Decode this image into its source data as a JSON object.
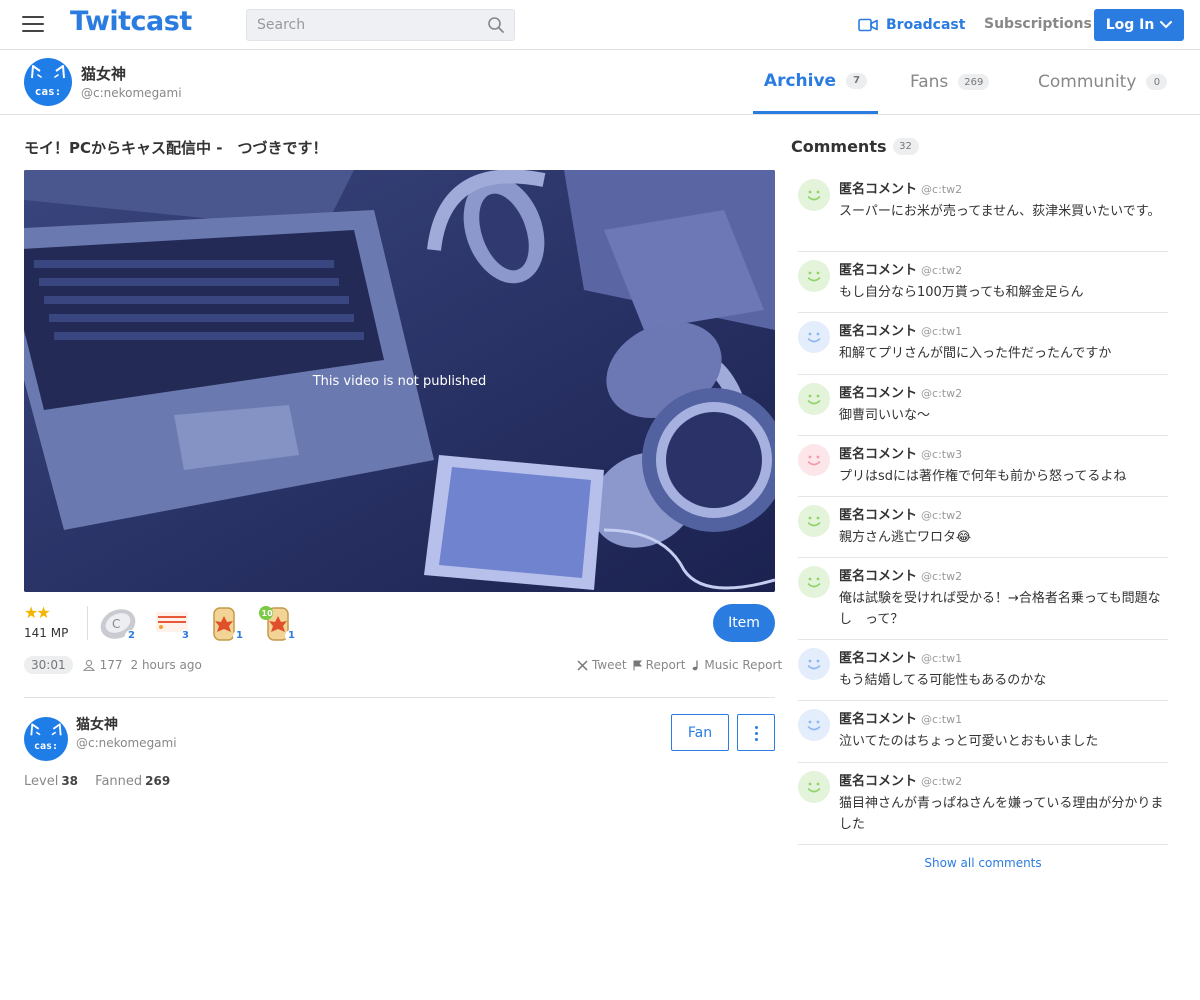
{
  "header": {
    "logo": "Twitcast",
    "search_placeholder": "Search",
    "broadcast_label": "Broadcast",
    "subscriptions_label": "Subscriptions",
    "login_label": "Log In",
    "accent_color": "#2b7ce0"
  },
  "profile": {
    "avatar_text": "cas:",
    "name": "猫女神",
    "handle": "@c:nekomegami"
  },
  "tabs": [
    {
      "label": "Archive",
      "count": "7",
      "active": true
    },
    {
      "label": "Fans",
      "count": "269",
      "active": false
    },
    {
      "label": "Community",
      "count": "0",
      "active": false
    }
  ],
  "video": {
    "title": "モイ！PCからキャス配信中 -　つづきです！",
    "overlay_message": "This video is not published",
    "rating_stars": "★★",
    "rating_value": 1.5,
    "mp": "141 MP",
    "gifts": [
      {
        "icon": "tea-gift-icon",
        "count": "2"
      },
      {
        "icon": "sports-day-gift-icon",
        "count": "3"
      },
      {
        "icon": "maple-gift-icon",
        "count": "1"
      },
      {
        "icon": "maple-10-gift-icon",
        "count": "1"
      }
    ],
    "item_label": "Item",
    "duration": "30:01",
    "viewers": "177",
    "time_ago": "2 hours ago",
    "actions": {
      "tweet": "Tweet",
      "report": "Report",
      "music_report": "Music Report"
    }
  },
  "broadcaster": {
    "avatar_text": "cas:",
    "name": "猫女神",
    "handle": "@c:nekomegami",
    "fan_label": "Fan",
    "level_label": "Level",
    "level": "38",
    "fanned_label": "Fanned",
    "fanned": "269"
  },
  "comments": {
    "title": "Comments",
    "count": "32",
    "show_all_label": "Show all comments",
    "items": [
      {
        "name": "匿名コメント",
        "id": "@c:tw2",
        "text": "スーパーにお米が売ってません、荻津米買いたいです。",
        "color": "#8fd36a"
      },
      {
        "name": "匿名コメント",
        "id": "@c:tw2",
        "text": "もし自分なら100万貰っても和解金足らん",
        "color": "#8fd36a"
      },
      {
        "name": "匿名コメント",
        "id": "@c:tw1",
        "text": "和解てプリさんが間に入った件だったんですか",
        "color": "#8fb8f0"
      },
      {
        "name": "匿名コメント",
        "id": "@c:tw2",
        "text": "御曹司いいな〜",
        "color": "#8fd36a"
      },
      {
        "name": "匿名コメント",
        "id": "@c:tw3",
        "text": "プリはsdには著作権で何年も前から怒ってるよね",
        "color": "#f29aa6"
      },
      {
        "name": "匿名コメント",
        "id": "@c:tw2",
        "text": "親方さん逃亡ワロタ😂",
        "color": "#8fd36a"
      },
      {
        "name": "匿名コメント",
        "id": "@c:tw2",
        "text": "俺は試験を受ければ受かる！→合格者名乗っても問題なし　って？",
        "color": "#8fd36a"
      },
      {
        "name": "匿名コメント",
        "id": "@c:tw1",
        "text": "もう結婚してる可能性もあるのかな",
        "color": "#8fb8f0"
      },
      {
        "name": "匿名コメント",
        "id": "@c:tw1",
        "text": "泣いてたのはちょっと可愛いとおもいました",
        "color": "#8fb8f0"
      },
      {
        "name": "匿名コメント",
        "id": "@c:tw2",
        "text": "猫目神さんが青っぱねさんを嫌っている理由が分かりました",
        "color": "#8fd36a"
      }
    ]
  }
}
